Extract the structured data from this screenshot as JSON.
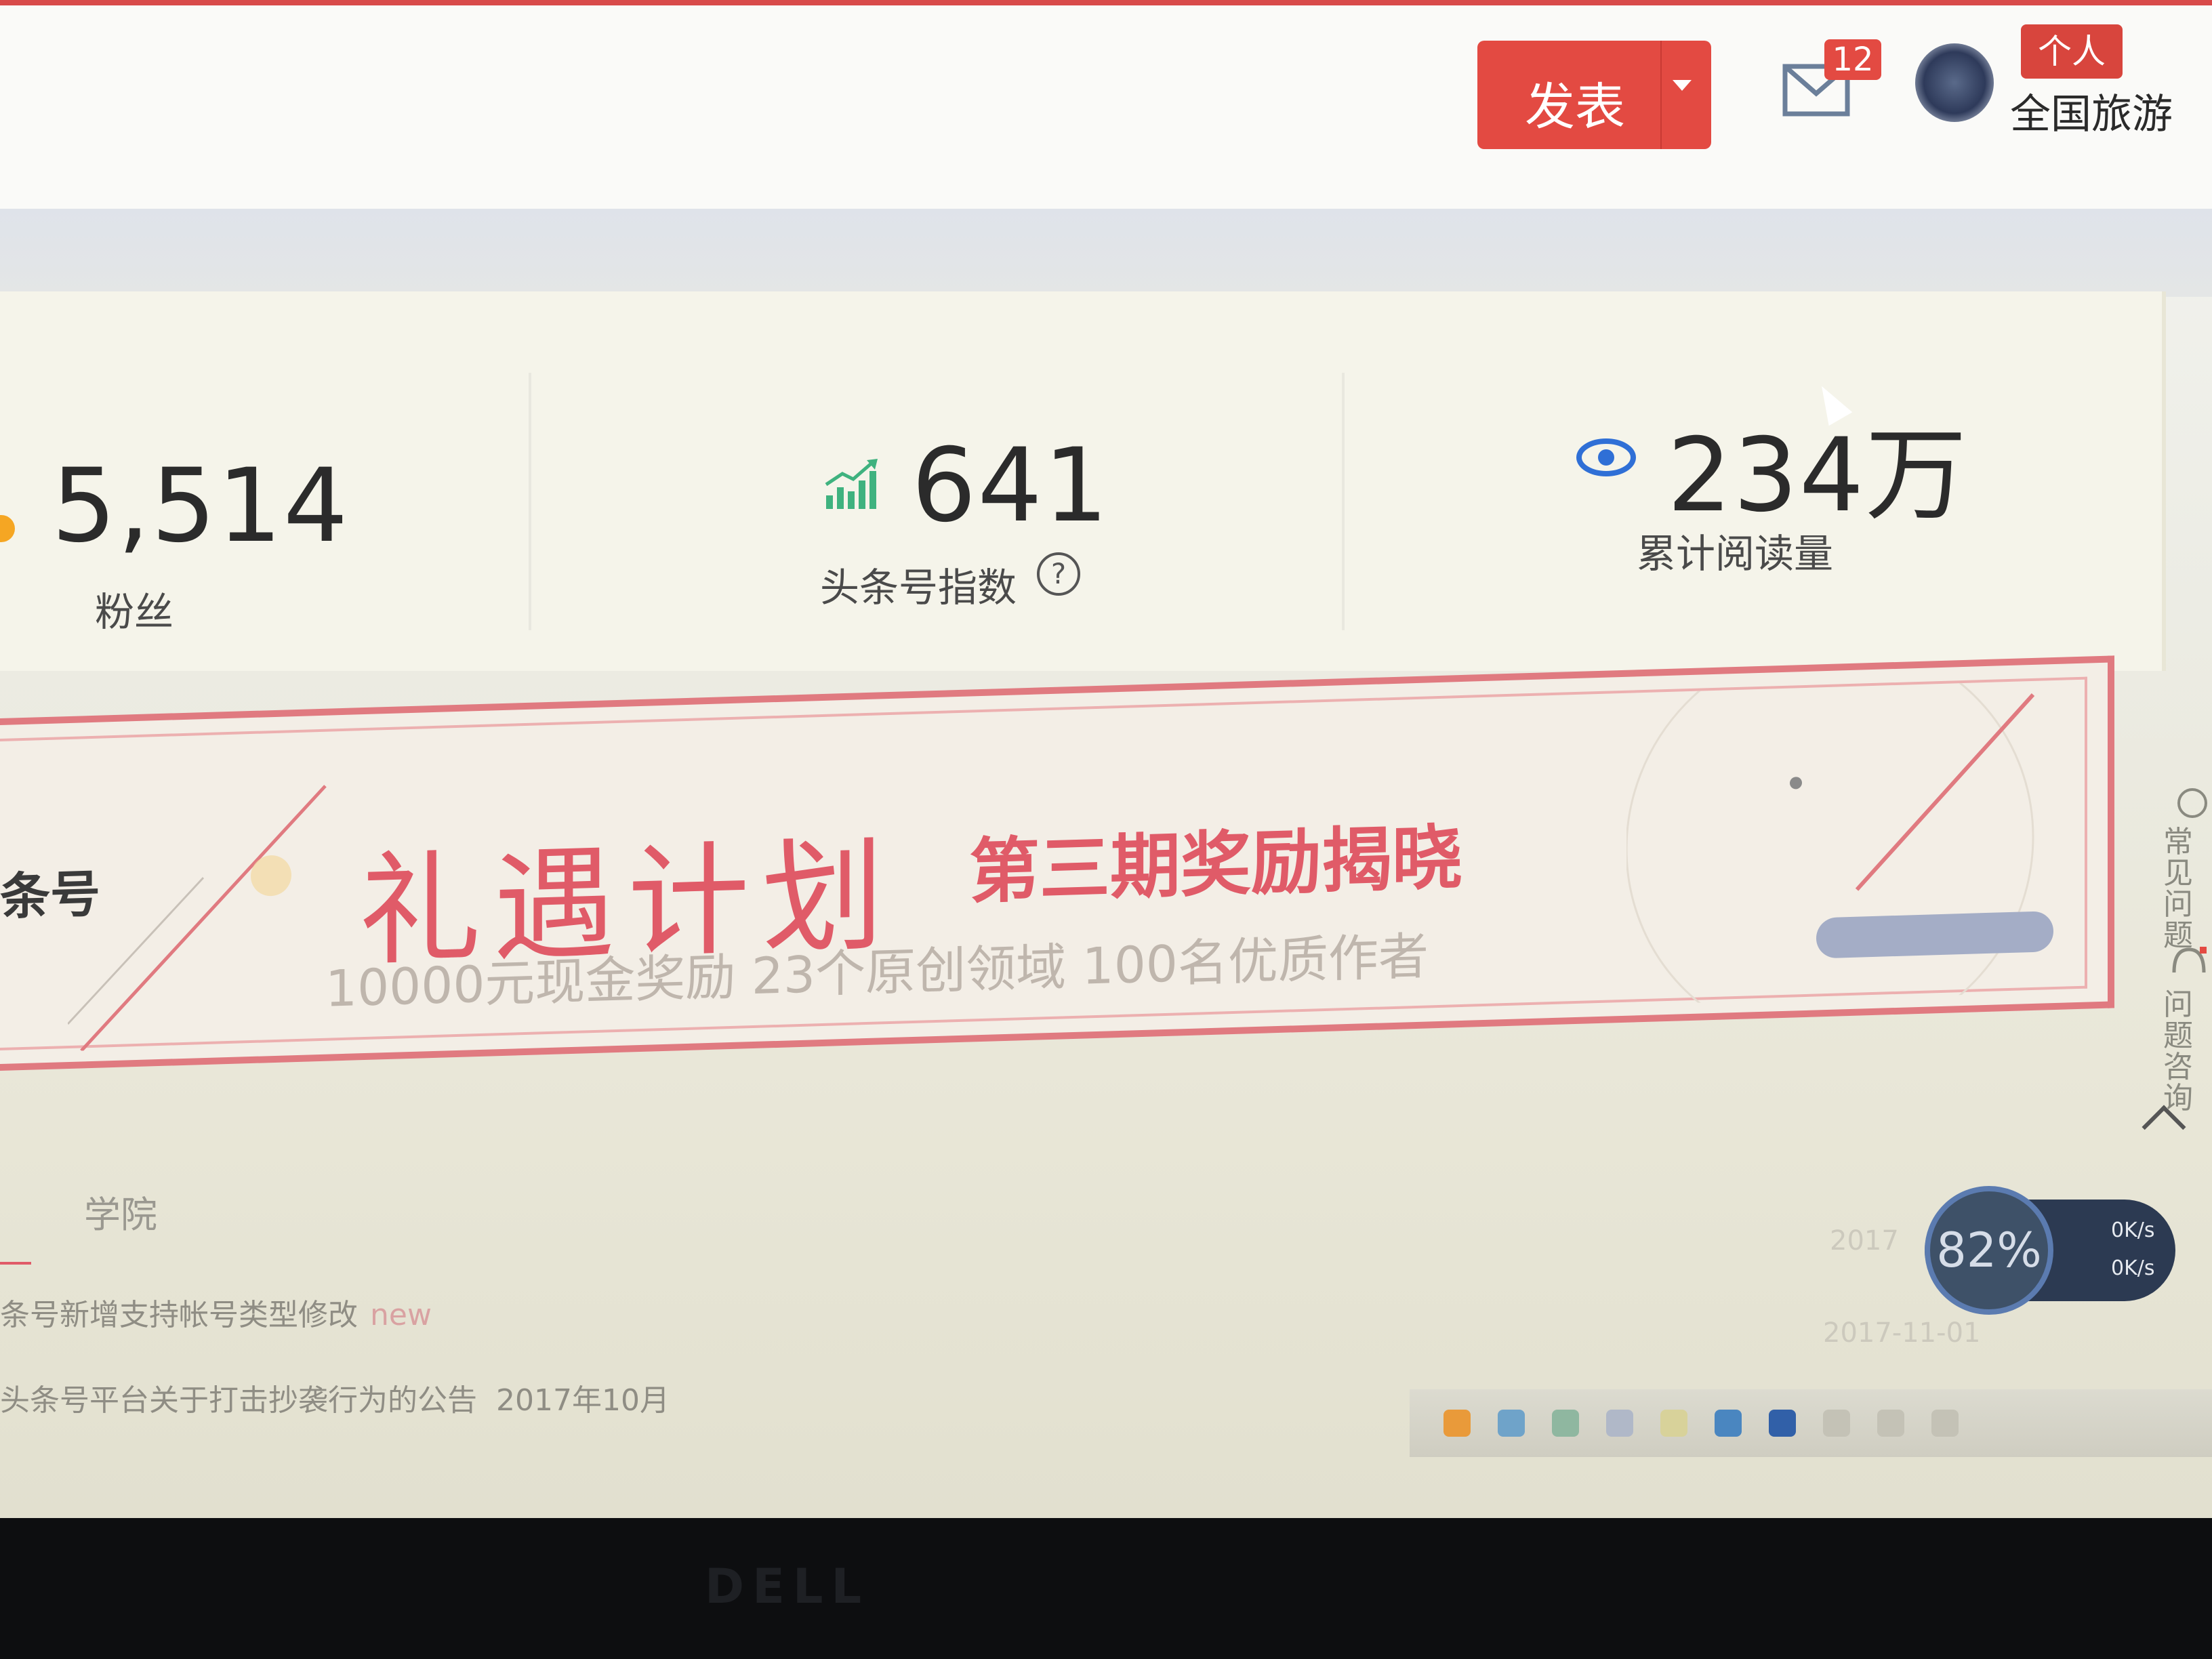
{
  "header": {
    "publish_label": "发表",
    "mail_count": "12",
    "personal_badge": "个人",
    "account_name": "全国旅游"
  },
  "stats": {
    "fans_value": "5,514",
    "fans_label": "粉丝",
    "index_value": "641",
    "index_label": "头条号指数",
    "reads_value": "234万",
    "reads_label": "累计阅读量"
  },
  "banner": {
    "brand": "条号",
    "title": "礼遇计划",
    "subtitle": "第三期奖励揭晓",
    "description": "10000元现金奖励  23个原创领域  100名优质作者"
  },
  "side_tools": {
    "faq_label": "常见问题",
    "consult_label": "问题咨询"
  },
  "tabs": {
    "college": "学院"
  },
  "notices": [
    {
      "text": "条号新增支持帐号类型修改",
      "tag": "new",
      "date": "2017"
    },
    {
      "text": "头条号平台关于打击抄袭行为的公告",
      "date": "2017年10月",
      "side_date": "2017-11-01"
    }
  ],
  "speed": {
    "percent": "82%",
    "up_rate": "0K/s",
    "down_rate": "0K/s"
  },
  "colors": {
    "brand_red": "#e34a42",
    "banner_pink": "#e05b68",
    "index_green": "#3fb27f",
    "eye_blue": "#2f6fd6"
  }
}
